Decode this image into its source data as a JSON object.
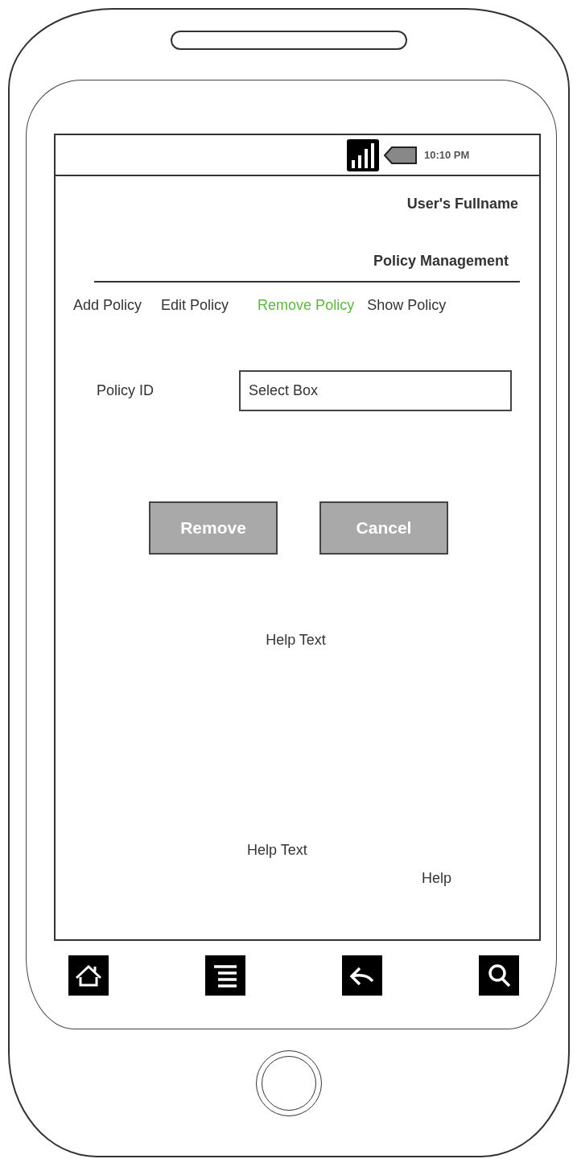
{
  "status_bar": {
    "time": "10:10 PM"
  },
  "header": {
    "user_name": "User's Fullname",
    "section_title": "Policy Management"
  },
  "tabs": [
    {
      "label": "Add Policy",
      "selected": false
    },
    {
      "label": "Edit Policy",
      "selected": false
    },
    {
      "label": "Remove Policy",
      "selected": true
    },
    {
      "label": "Show Policy",
      "selected": false
    }
  ],
  "form": {
    "label": "Policy ID",
    "select_value": "Select Box"
  },
  "buttons": [
    "Remove",
    "Cancel"
  ],
  "help_texts": [
    "Help Text",
    "Help Text"
  ],
  "help_link": "Help"
}
